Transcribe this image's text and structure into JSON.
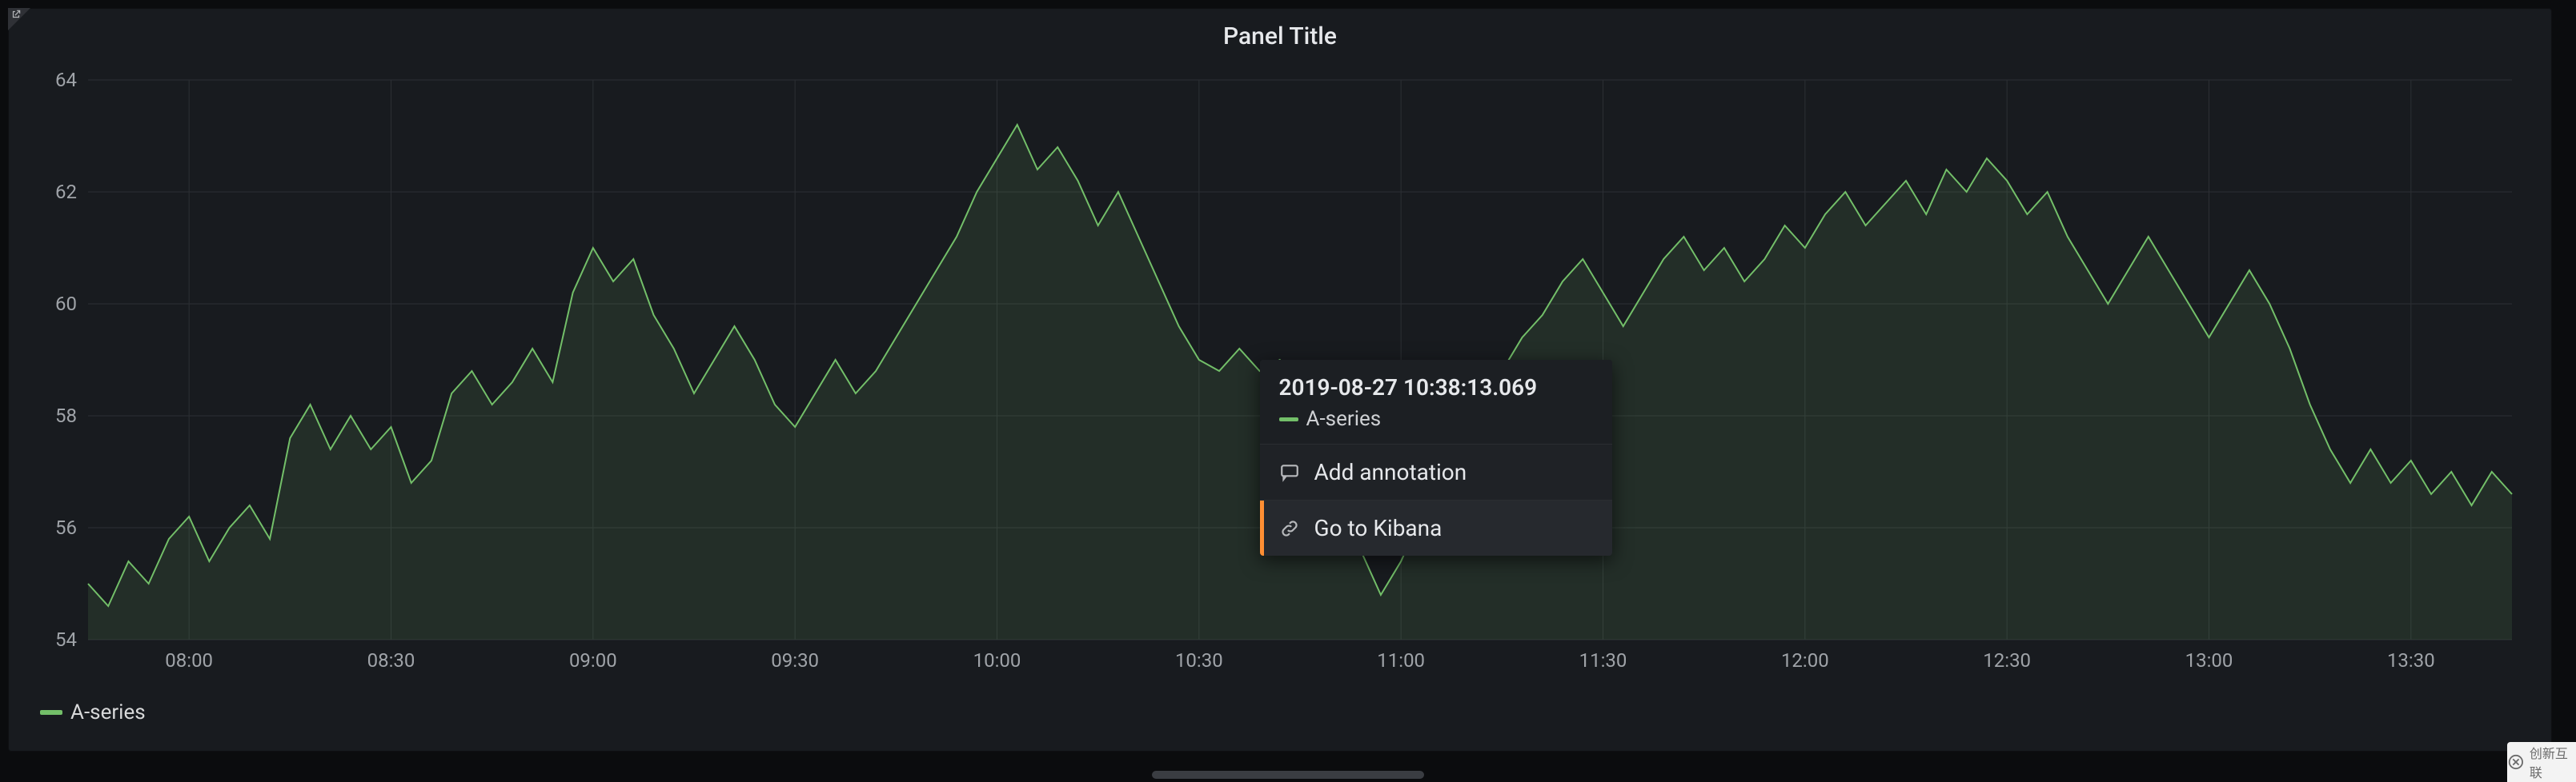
{
  "panel": {
    "title": "Panel Title"
  },
  "legend": {
    "items": [
      {
        "label": "A-series",
        "color": "#73bf69"
      }
    ]
  },
  "context_menu": {
    "timestamp": "2019-08-27 10:38:13.069",
    "series_label": "A-series",
    "items": [
      {
        "label": "Add annotation",
        "icon": "comment-icon",
        "highlight": false
      },
      {
        "label": "Go to Kibana",
        "icon": "link-icon",
        "highlight": true
      }
    ]
  },
  "colors": {
    "series": "#73bf69",
    "bg_panel": "#181b1f",
    "bg_page": "#0b0c0e",
    "accent": "#ff8f33"
  },
  "watermark": {
    "text": "创新互联"
  },
  "chart_data": {
    "type": "line",
    "title": "Panel Title",
    "xlabel": "",
    "ylabel": "",
    "ylim": [
      54,
      64
    ],
    "x_ticks": [
      "08:00",
      "08:30",
      "09:00",
      "09:30",
      "10:00",
      "10:30",
      "11:00",
      "11:30",
      "12:00",
      "12:30",
      "13:00",
      "13:30"
    ],
    "y_ticks": [
      54,
      56,
      58,
      60,
      62,
      64
    ],
    "grid": true,
    "legend_position": "bottom-left",
    "x": [
      "07:45",
      "07:48",
      "07:51",
      "07:54",
      "07:57",
      "08:00",
      "08:03",
      "08:06",
      "08:09",
      "08:12",
      "08:15",
      "08:18",
      "08:21",
      "08:24",
      "08:27",
      "08:30",
      "08:33",
      "08:36",
      "08:39",
      "08:42",
      "08:45",
      "08:48",
      "08:51",
      "08:54",
      "08:57",
      "09:00",
      "09:03",
      "09:06",
      "09:09",
      "09:12",
      "09:15",
      "09:18",
      "09:21",
      "09:24",
      "09:27",
      "09:30",
      "09:33",
      "09:36",
      "09:39",
      "09:42",
      "09:45",
      "09:48",
      "09:51",
      "09:54",
      "09:57",
      "10:00",
      "10:03",
      "10:06",
      "10:09",
      "10:12",
      "10:15",
      "10:18",
      "10:21",
      "10:24",
      "10:27",
      "10:30",
      "10:33",
      "10:36",
      "10:39",
      "10:42",
      "10:45",
      "10:48",
      "10:51",
      "10:54",
      "10:57",
      "11:00",
      "11:03",
      "11:06",
      "11:09",
      "11:12",
      "11:15",
      "11:18",
      "11:21",
      "11:24",
      "11:27",
      "11:30",
      "11:33",
      "11:36",
      "11:39",
      "11:42",
      "11:45",
      "11:48",
      "11:51",
      "11:54",
      "11:57",
      "12:00",
      "12:03",
      "12:06",
      "12:09",
      "12:12",
      "12:15",
      "12:18",
      "12:21",
      "12:24",
      "12:27",
      "12:30",
      "12:33",
      "12:36",
      "12:39",
      "12:42",
      "12:45",
      "12:48",
      "12:51",
      "12:54",
      "12:57",
      "13:00",
      "13:03",
      "13:06",
      "13:09",
      "13:12",
      "13:15",
      "13:18",
      "13:21",
      "13:24",
      "13:27",
      "13:30",
      "13:33",
      "13:36",
      "13:39",
      "13:42",
      "13:45"
    ],
    "series": [
      {
        "name": "A-series",
        "color": "#73bf69",
        "values": [
          55.0,
          54.6,
          55.4,
          55.0,
          55.8,
          56.2,
          55.4,
          56.0,
          56.4,
          55.8,
          57.6,
          58.2,
          57.4,
          58.0,
          57.4,
          57.8,
          56.8,
          57.2,
          58.4,
          58.8,
          58.2,
          58.6,
          59.2,
          58.6,
          60.2,
          61.0,
          60.4,
          60.8,
          59.8,
          59.2,
          58.4,
          59.0,
          59.6,
          59.0,
          58.2,
          57.8,
          58.4,
          59.0,
          58.4,
          58.8,
          59.4,
          60.0,
          60.6,
          61.2,
          62.0,
          62.6,
          63.2,
          62.4,
          62.8,
          62.2,
          61.4,
          62.0,
          61.2,
          60.4,
          59.6,
          59.0,
          58.8,
          59.2,
          58.8,
          59.0,
          58.6,
          58.2,
          56.8,
          55.6,
          54.8,
          55.4,
          56.2,
          56.8,
          57.4,
          58.0,
          58.8,
          59.4,
          59.8,
          60.4,
          60.8,
          60.2,
          59.6,
          60.2,
          60.8,
          61.2,
          60.6,
          61.0,
          60.4,
          60.8,
          61.4,
          61.0,
          61.6,
          62.0,
          61.4,
          61.8,
          62.2,
          61.6,
          62.4,
          62.0,
          62.6,
          62.2,
          61.6,
          62.0,
          61.2,
          60.6,
          60.0,
          60.6,
          61.2,
          60.6,
          60.0,
          59.4,
          60.0,
          60.6,
          60.0,
          59.2,
          58.2,
          57.4,
          56.8,
          57.4,
          56.8,
          57.2,
          56.6,
          57.0,
          56.4,
          57.0,
          56.6
        ]
      }
    ]
  }
}
